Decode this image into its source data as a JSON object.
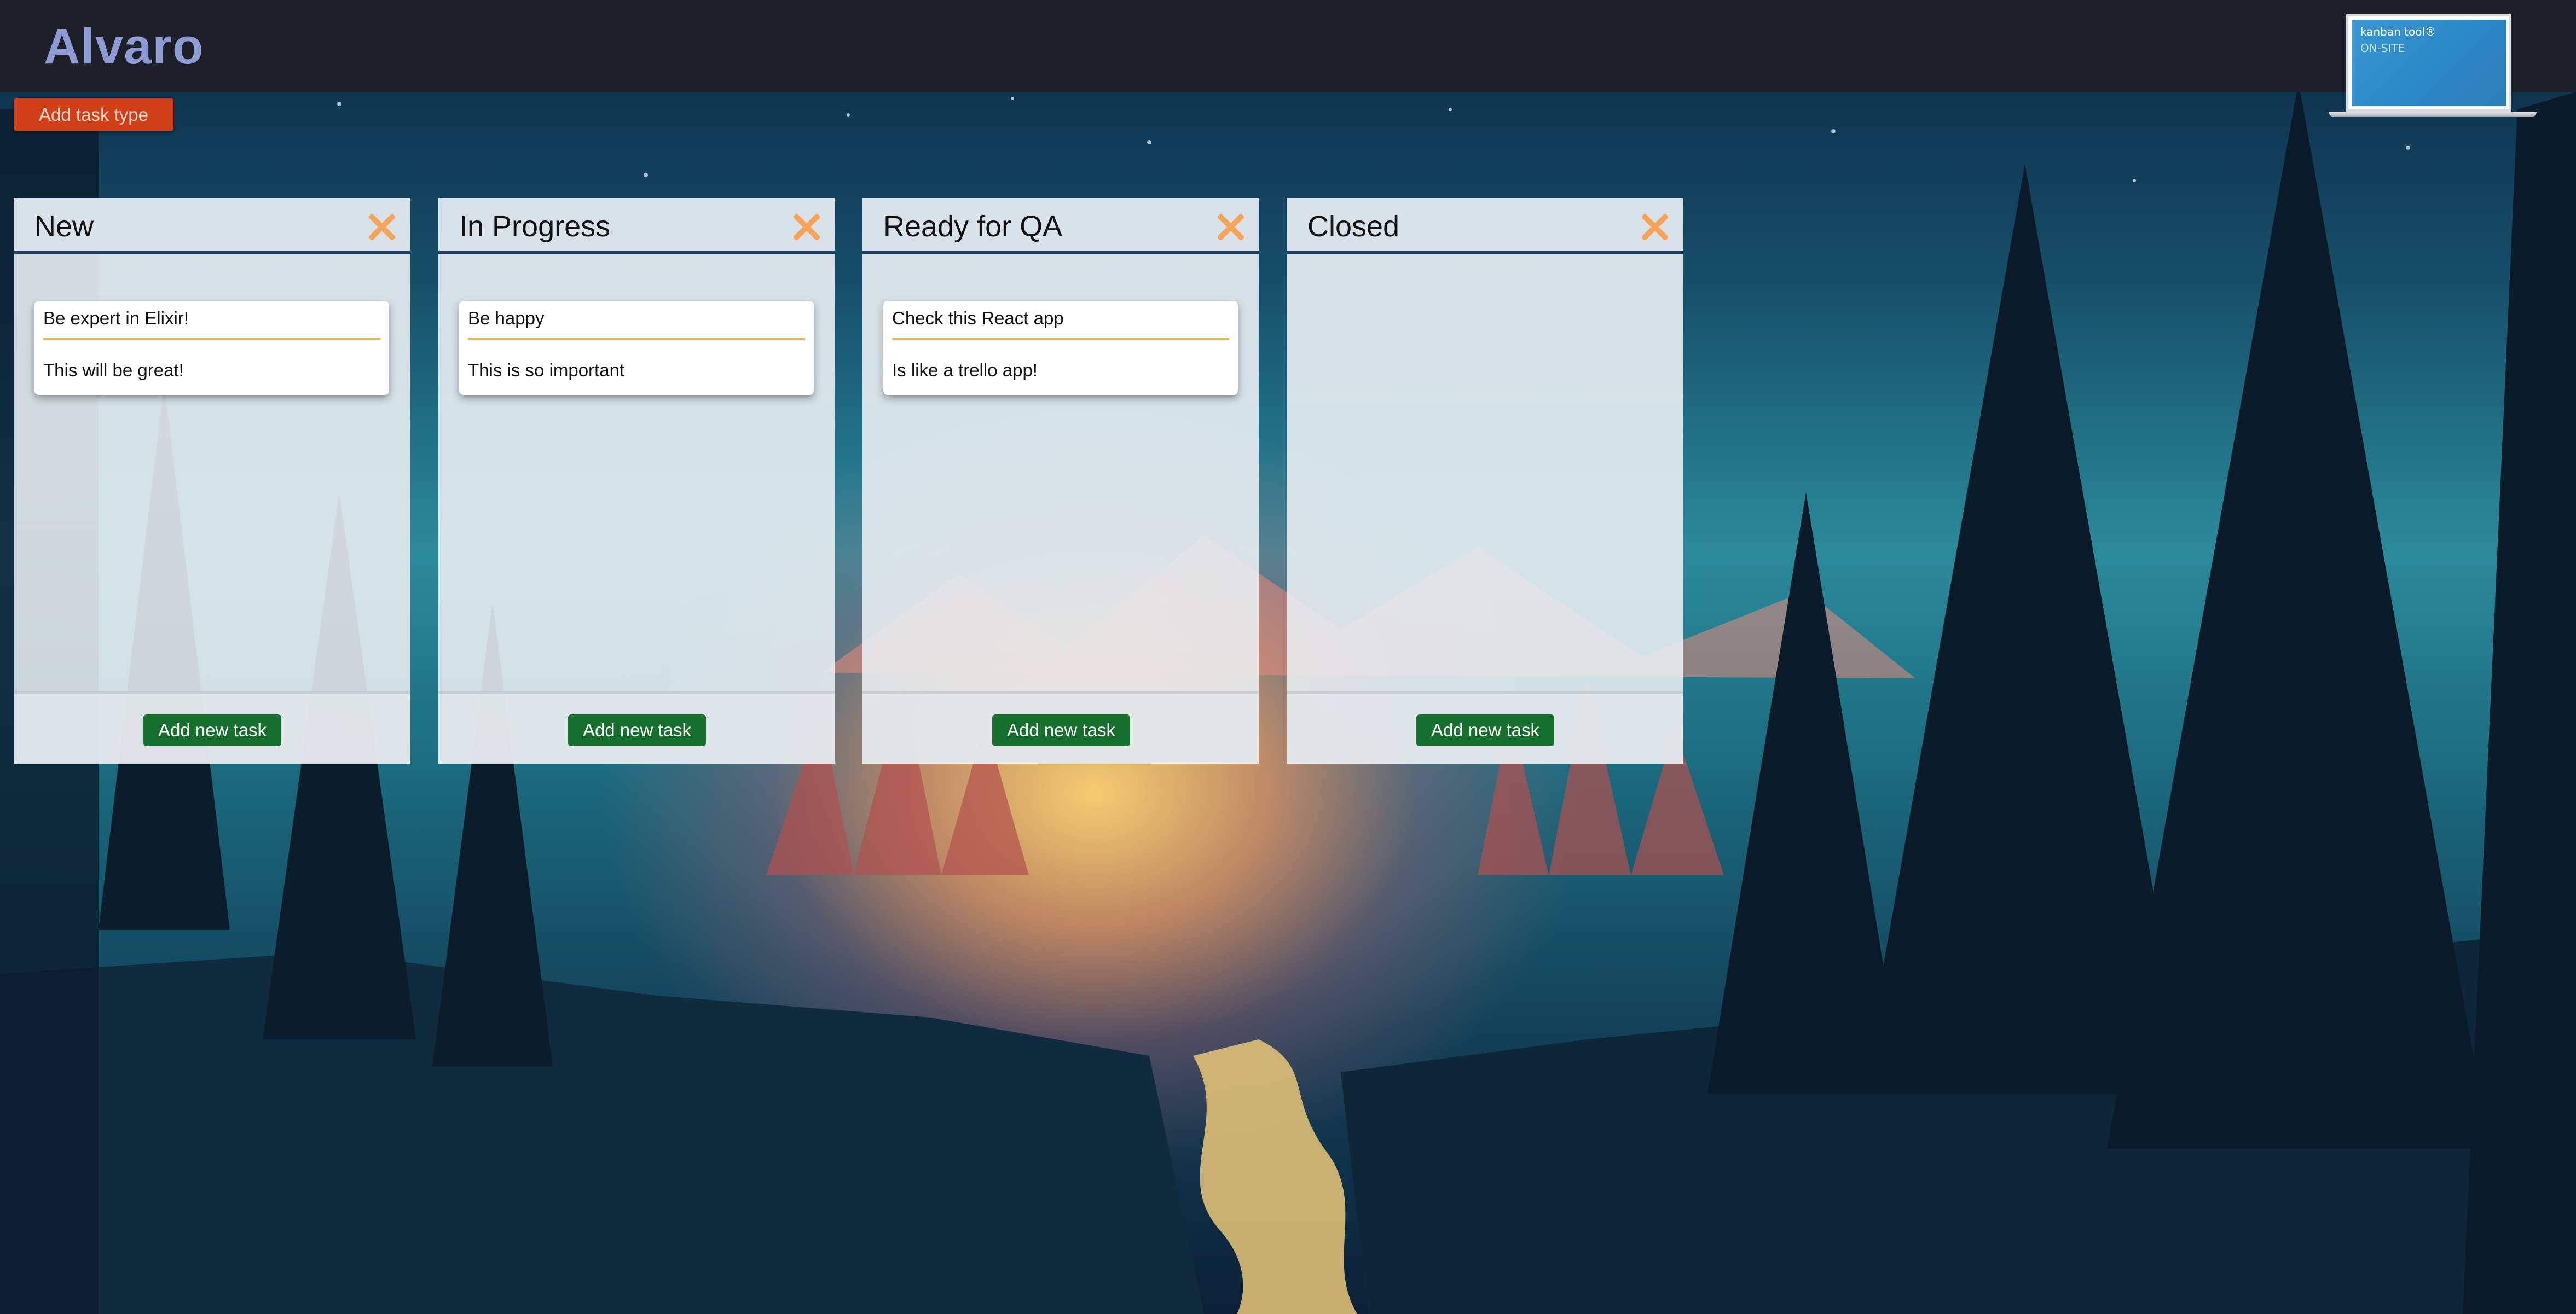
{
  "header": {
    "brand": "Alvaro",
    "promo": {
      "line1": "kanban tool®",
      "line2": "ON-SITE"
    }
  },
  "toolbar": {
    "add_task_type_label": "Add task type"
  },
  "columns": [
    {
      "title": "New",
      "close_icon": "close-x-icon",
      "tasks": [
        {
          "title": "Be expert in Elixir!",
          "description": "This will be great!"
        }
      ],
      "add_task_label": "Add new task"
    },
    {
      "title": "In Progress",
      "close_icon": "close-x-icon",
      "tasks": [
        {
          "title": "Be happy",
          "description": "This is so important"
        }
      ],
      "add_task_label": "Add new task"
    },
    {
      "title": "Ready for QA",
      "close_icon": "close-x-icon",
      "tasks": [
        {
          "title": "Check this React app",
          "description": "Is like a trello app!"
        }
      ],
      "add_task_label": "Add new task"
    },
    {
      "title": "Closed",
      "close_icon": "close-x-icon",
      "tasks": [],
      "add_task_label": "Add new task"
    }
  ],
  "colors": {
    "header_bg": "#1e2029",
    "brand_text": "#8f9bd3",
    "add_task_type_bg": "#cf3f19",
    "add_task_bg": "#176f2d",
    "close_icon": "#f6a45a",
    "card_divider": "#e5b24d"
  }
}
